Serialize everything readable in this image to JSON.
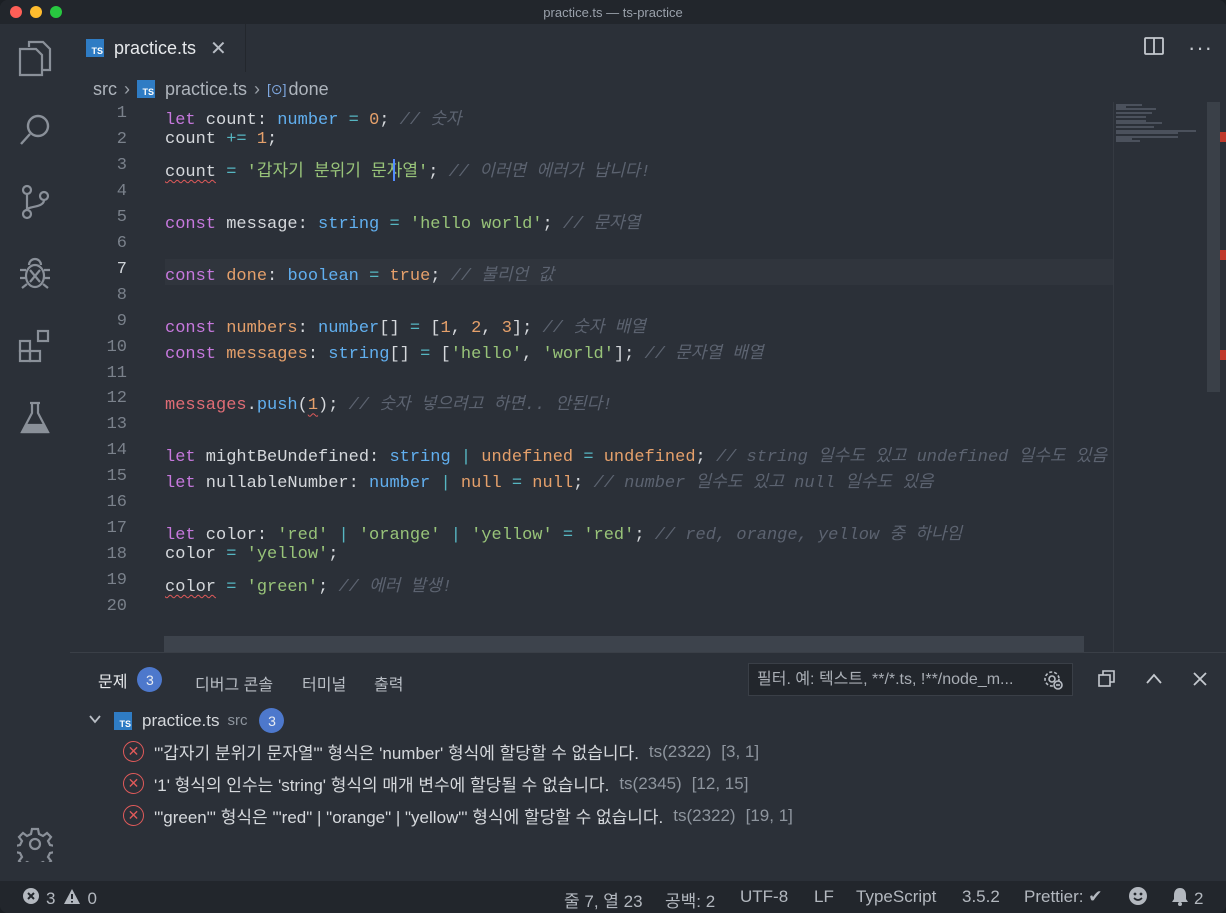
{
  "window": {
    "title": "practice.ts — ts-practice"
  },
  "tab": {
    "name": "practice.ts",
    "icon_label": "TS"
  },
  "breadcrumb": {
    "folder": "src",
    "file": "practice.ts",
    "symbol_icon": "[⊙]",
    "symbol": "done"
  },
  "editor": {
    "line_numbers": [
      "1",
      "2",
      "3",
      "4",
      "5",
      "6",
      "7",
      "8",
      "9",
      "10",
      "11",
      "12",
      "13",
      "14",
      "15",
      "16",
      "17",
      "18",
      "19",
      "20"
    ],
    "current_line": 7,
    "lines": [
      "let count: number = 0; // 숫자",
      "count += 1;",
      "count = '갑자기 분위기 문자열'; // 이러면 에러가 납니다!",
      "",
      "const message: string = 'hello world'; // 문자열",
      "",
      "const done: boolean = true; // 불리언 값",
      "",
      "const numbers: number[] = [1, 2, 3]; // 숫자 배열",
      "const messages: string[] = ['hello', 'world']; // 문자열 배열",
      "",
      "messages.push(1); // 숫자 넣으려고 하면.. 안된다!",
      "",
      "let mightBeUndefined: string | undefined = undefined; // string 일수도 있고 undefined 일수도 있음",
      "let nullableNumber: number | null = null; // number 일수도 있고 null 일수도 있음",
      "",
      "let color: 'red' | 'orange' | 'yellow' = 'red'; // red, orange, yellow 중 하나임",
      "color = 'yellow';",
      "color = 'green'; // 에러 발생!",
      ""
    ]
  },
  "panel": {
    "tabs": [
      "문제",
      "디버그 콘솔",
      "터미널",
      "출력"
    ],
    "problem_count": "3",
    "filter_placeholder": "필터. 예: 텍스트, **/*.ts, !**/node_m...",
    "group": {
      "file": "practice.ts",
      "folder": "src",
      "count": "3"
    },
    "problems": [
      {
        "message": "'\"갑자기 분위기 문자열\"' 형식은 'number' 형식에 할당할 수 없습니다.",
        "code": "ts(2322)",
        "pos": "[3, 1]"
      },
      {
        "message": "'1' 형식의 인수는 'string' 형식의 매개 변수에 할당될 수 없습니다.",
        "code": "ts(2345)",
        "pos": "[12, 15]"
      },
      {
        "message": "'\"green\"' 형식은 '\"red\" | \"orange\" | \"yellow\"' 형식에 할당할 수 없습니다.",
        "code": "ts(2322)",
        "pos": "[19, 1]"
      }
    ]
  },
  "status": {
    "errors": "3",
    "warnings": "0",
    "cursor": "줄 7, 열 23",
    "indent": "공백: 2",
    "encoding": "UTF-8",
    "eol": "LF",
    "language": "TypeScript",
    "version": "3.5.2",
    "prettier": "Prettier: ✔",
    "notifications": "2"
  },
  "icons": [
    "explorer-icon",
    "search-icon",
    "source-control-icon",
    "debug-icon",
    "extensions-icon",
    "test-icon",
    "settings-icon",
    "split-editor-icon",
    "more-icon",
    "maximize-icon",
    "collapse-icon",
    "close-icon",
    "error-icon",
    "warning-icon",
    "smiley-icon",
    "bell-icon",
    "filter-settings-icon"
  ],
  "colors": {
    "keyword": "#c678dd",
    "type": "#61afef",
    "string": "#98c379",
    "number": "#e5a06b",
    "comment": "#5c6370",
    "error": "#e05a5a",
    "badge": "#4d78cc"
  }
}
